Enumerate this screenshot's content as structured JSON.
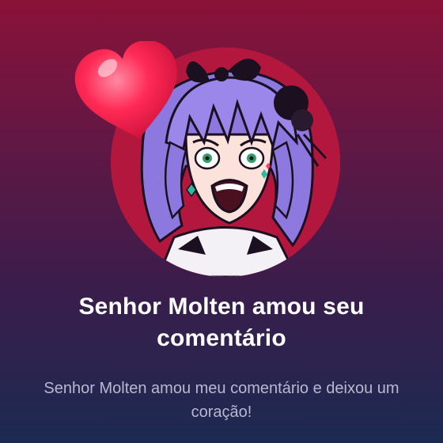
{
  "notification": {
    "title": "Senhor Molten amou seu comentário",
    "message": "Senhor Molten amou meu comentário e deixou um coração!"
  },
  "icons": {
    "reaction": "heart-icon",
    "avatar": "anime-character-avatar"
  },
  "colors": {
    "background_top": "#8a1238",
    "background_bottom": "#1c2a52",
    "avatar_bg": "#b3173e",
    "heart": "#ff2a55",
    "title_text": "#ffffff",
    "message_text": "#b9b8cf"
  }
}
